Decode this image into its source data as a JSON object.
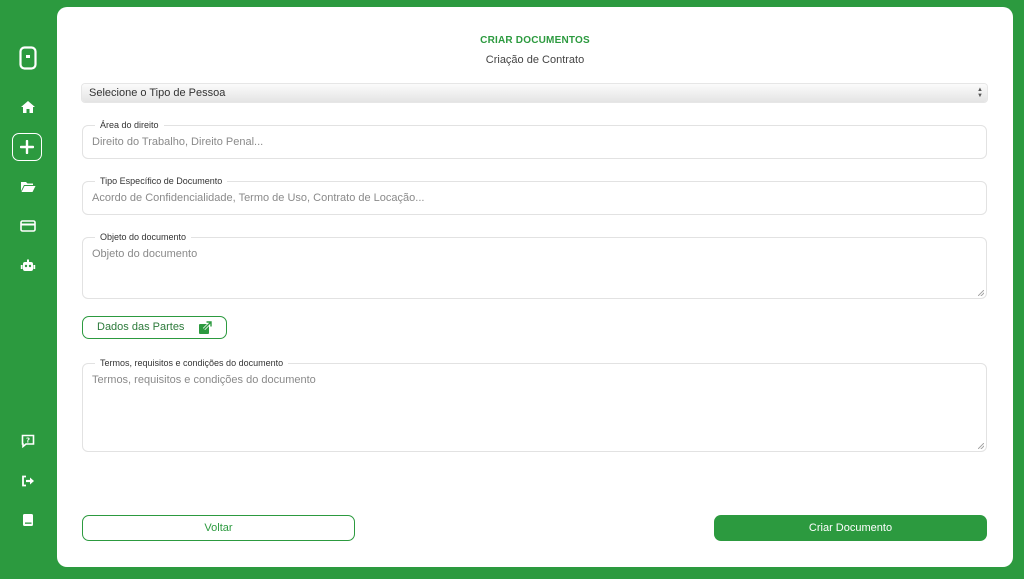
{
  "sidebar": {
    "icons": [
      "phone-logo-icon",
      "home-icon",
      "plus-icon",
      "folder-open-icon",
      "credit-card-icon",
      "robot-icon",
      "help-chat-icon",
      "logout-icon",
      "book-icon"
    ]
  },
  "header": {
    "title": "CRIAR DOCUMENTOS",
    "subtitle": "Criação de Contrato"
  },
  "form": {
    "person_type_select": {
      "value": "Selecione o Tipo de Pessoa"
    },
    "area": {
      "label": "Área do direito",
      "placeholder": "Direito do Trabalho, Direito Penal..."
    },
    "tipo": {
      "label": "Tipo Específico de Documento",
      "placeholder": "Acordo de Confidencialidade, Termo de Uso, Contrato de Locação..."
    },
    "objeto": {
      "label": "Objeto do documento",
      "placeholder": "Objeto do documento"
    },
    "partes_button": "Dados das Partes",
    "termos": {
      "label": "Termos, requisitos e condições do documento",
      "placeholder": "Termos, requisitos e condições do documento"
    }
  },
  "actions": {
    "back": "Voltar",
    "create": "Criar Documento"
  },
  "colors": {
    "brand": "#2c9a3f",
    "panel": "#ffffff"
  }
}
